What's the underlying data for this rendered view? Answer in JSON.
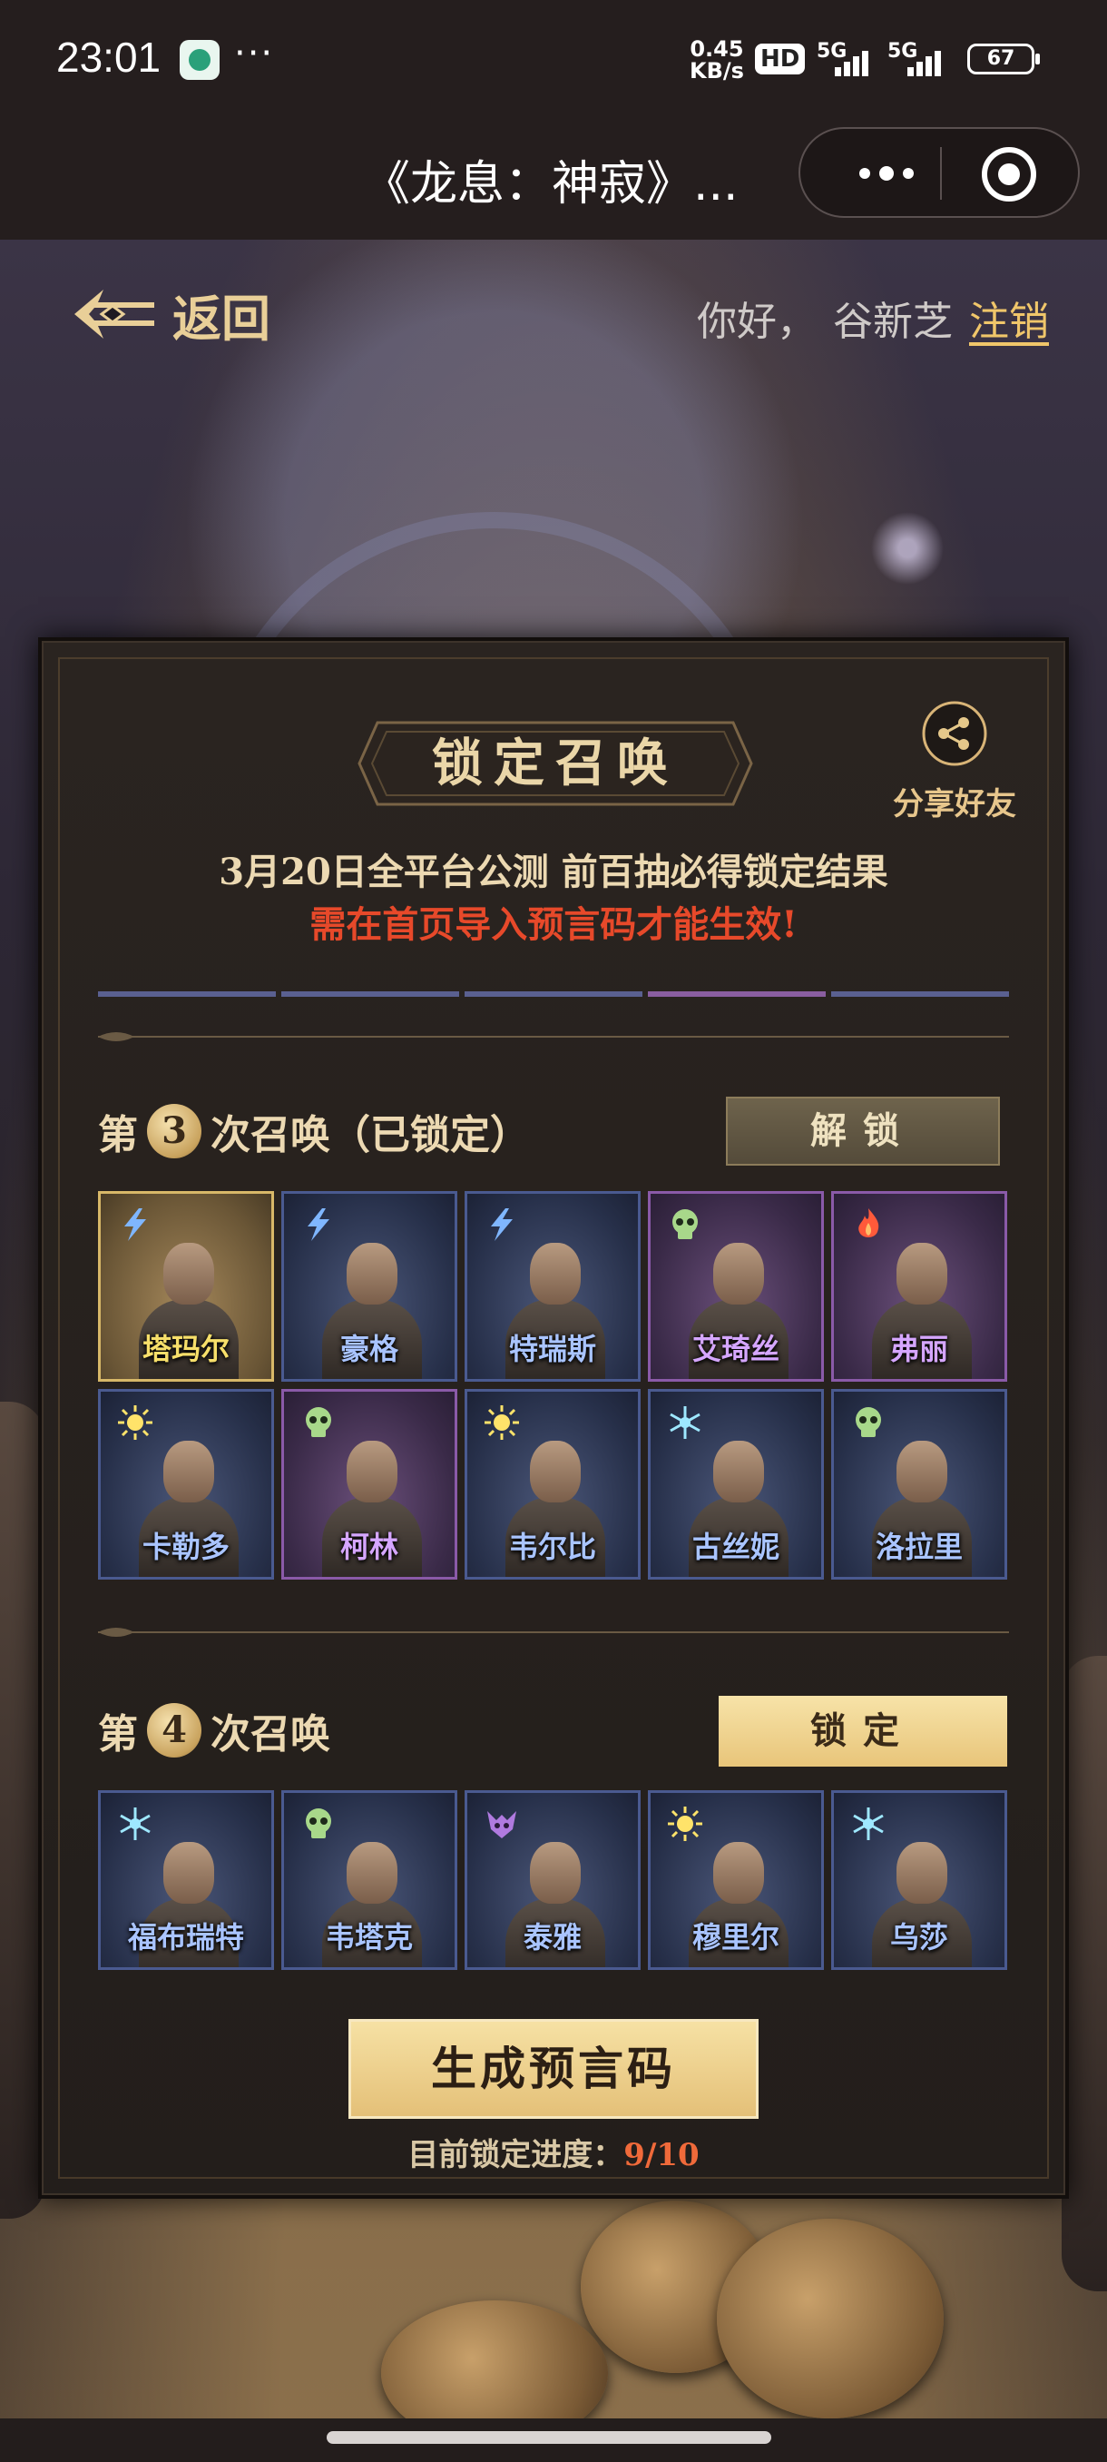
{
  "status_bar": {
    "time": "23:01",
    "app_icon": "wechat-mini-icon",
    "more": "···",
    "speed_value": "0.45",
    "speed_unit": "KB/s",
    "hd_badge": "HD",
    "net1": "5G",
    "net2": "5G",
    "battery": "67"
  },
  "title_bar": {
    "title": "《龙息：神寂》...",
    "more_icon": "more-dots-icon",
    "close_icon": "record-close-icon"
  },
  "header": {
    "back_label": "返回",
    "greeting": "你好，",
    "username": "谷新芝",
    "logout": "注销"
  },
  "panel": {
    "title": "锁定召唤",
    "share_label": "分享好友",
    "notice_line1": "3月20日全平台公测  前百抽必得锁定结果",
    "notice_line2": "需在首页导入预言码才能生效!",
    "accent_colors": {
      "gold": "#f7df6a",
      "blue": "#a9c4ff",
      "purple": "#d5a6ff",
      "warning": "#e7492a"
    }
  },
  "summon3": {
    "prefix": "第",
    "number": "3",
    "suffix": "次召唤（已锁定）",
    "button": "解锁",
    "cards": [
      {
        "name": "塔玛尔",
        "element": "lightning-icon",
        "rarity": "gold"
      },
      {
        "name": "豪格",
        "element": "lightning-icon",
        "rarity": "blue"
      },
      {
        "name": "特瑞斯",
        "element": "lightning-icon",
        "rarity": "blue"
      },
      {
        "name": "艾琦丝",
        "element": "skull-icon",
        "rarity": "purple"
      },
      {
        "name": "弗丽",
        "element": "fire-icon",
        "rarity": "purple"
      },
      {
        "name": "卡勒多",
        "element": "sun-icon",
        "rarity": "blue"
      },
      {
        "name": "柯林",
        "element": "skull-icon",
        "rarity": "purple"
      },
      {
        "name": "韦尔比",
        "element": "sun-icon",
        "rarity": "blue"
      },
      {
        "name": "古丝妮",
        "element": "frost-icon",
        "rarity": "blue"
      },
      {
        "name": "洛拉里",
        "element": "skull-icon",
        "rarity": "blue"
      }
    ]
  },
  "summon4": {
    "prefix": "第",
    "number": "4",
    "suffix": "次召唤",
    "button": "锁定",
    "cards": [
      {
        "name": "福布瑞特",
        "element": "frost-icon",
        "rarity": "blue"
      },
      {
        "name": "韦塔克",
        "element": "skull-icon",
        "rarity": "blue"
      },
      {
        "name": "泰雅",
        "element": "demon-icon",
        "rarity": "blue"
      },
      {
        "name": "穆里尔",
        "element": "sun-icon",
        "rarity": "blue"
      },
      {
        "name": "乌莎",
        "element": "frost-icon",
        "rarity": "blue"
      }
    ]
  },
  "footer": {
    "generate_button": "生成预言码",
    "progress_label": "目前锁定进度：",
    "progress_value": "9/10",
    "progress_fraction": 0.9
  }
}
